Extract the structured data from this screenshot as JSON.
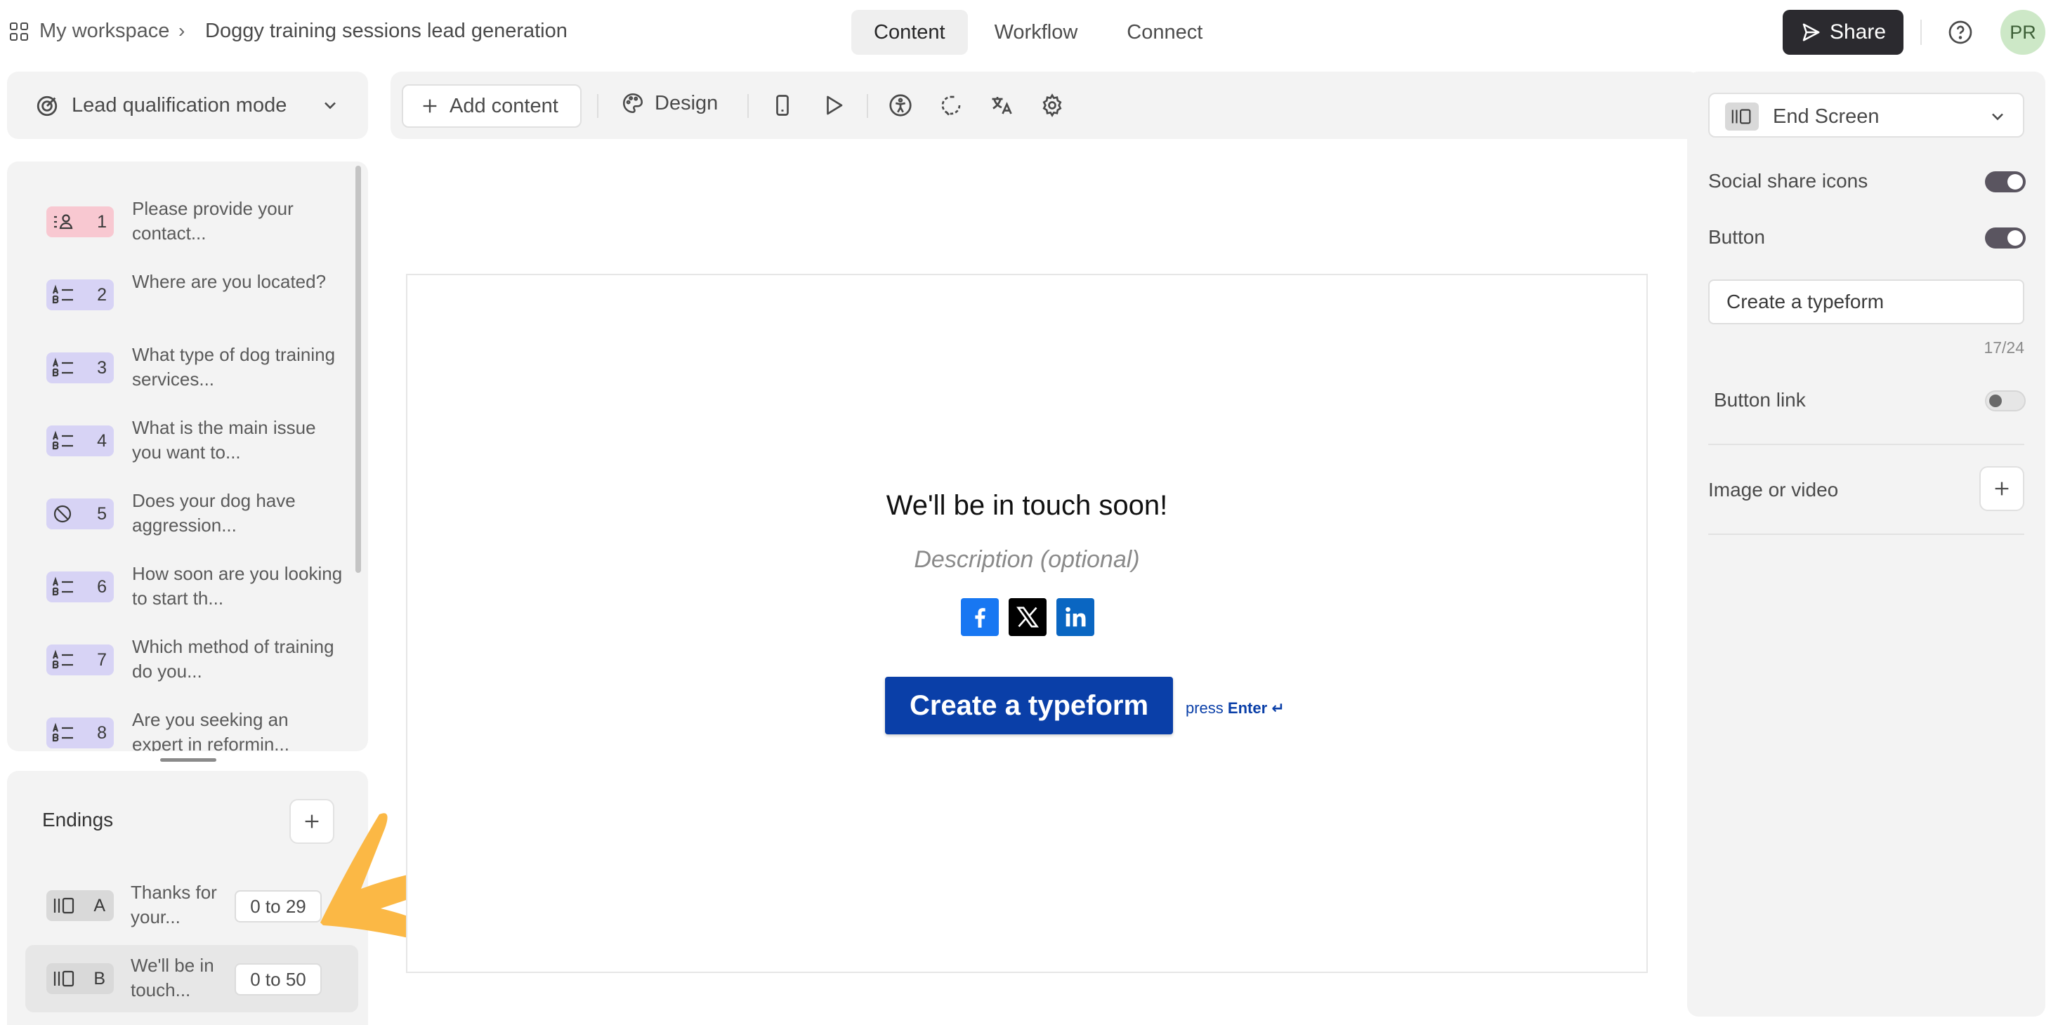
{
  "header": {
    "workspace": "My workspace",
    "separator": "›",
    "form_title": "Doggy training sessions lead generation",
    "tabs": [
      "Content",
      "Workflow",
      "Connect"
    ],
    "share": "Share",
    "avatar": "PR"
  },
  "mode": {
    "label": "Lead qualification mode"
  },
  "questions": [
    {
      "num": "1",
      "text": "Please provide your contact...",
      "type": "contact-icon",
      "color": "#f8c8d1"
    },
    {
      "num": "2",
      "text": "Where are you located?",
      "type": "multiple-choice-icon",
      "color": "#d7d3f5"
    },
    {
      "num": "3",
      "text": "What type of dog training services...",
      "type": "multiple-choice-icon",
      "color": "#d7d3f5"
    },
    {
      "num": "4",
      "text": "What is the main issue you want to...",
      "type": "multiple-choice-icon",
      "color": "#d7d3f5"
    },
    {
      "num": "5",
      "text": "Does your dog have aggression...",
      "type": "yes-no-icon",
      "color": "#d7d3f5"
    },
    {
      "num": "6",
      "text": "How soon are you looking to start th...",
      "type": "multiple-choice-icon",
      "color": "#d7d3f5"
    },
    {
      "num": "7",
      "text": "Which method of training do you...",
      "type": "multiple-choice-icon",
      "color": "#d7d3f5"
    },
    {
      "num": "8",
      "text": "Are you seeking an expert in reformin...",
      "type": "multiple-choice-icon",
      "color": "#d7d3f5"
    }
  ],
  "endings": {
    "title": "Endings",
    "items": [
      {
        "letter": "A",
        "text": "Thanks for your...",
        "range": "0 to 29"
      },
      {
        "letter": "B",
        "text": "We'll be in touch...",
        "range": "0 to 50"
      }
    ]
  },
  "toolbar": {
    "add_content": "Add content",
    "design": "Design"
  },
  "canvas": {
    "heading": "We'll be in touch soon!",
    "description": "Description (optional)",
    "button": "Create a typeform",
    "press": "press",
    "enter": "Enter ↵"
  },
  "right_panel": {
    "screen_type": "End Screen",
    "social_share_label": "Social share icons",
    "social_share_on": true,
    "button_label": "Button",
    "button_on": true,
    "button_text": "Create a typeform",
    "char_count": "17/24",
    "button_link_label": "Button link",
    "button_link_on": false,
    "image_label": "Image or video"
  },
  "colors": {
    "accent": "#0a3fa8",
    "share_bg": "#2b2a2f",
    "annotation_arrow": "#fbb845"
  }
}
